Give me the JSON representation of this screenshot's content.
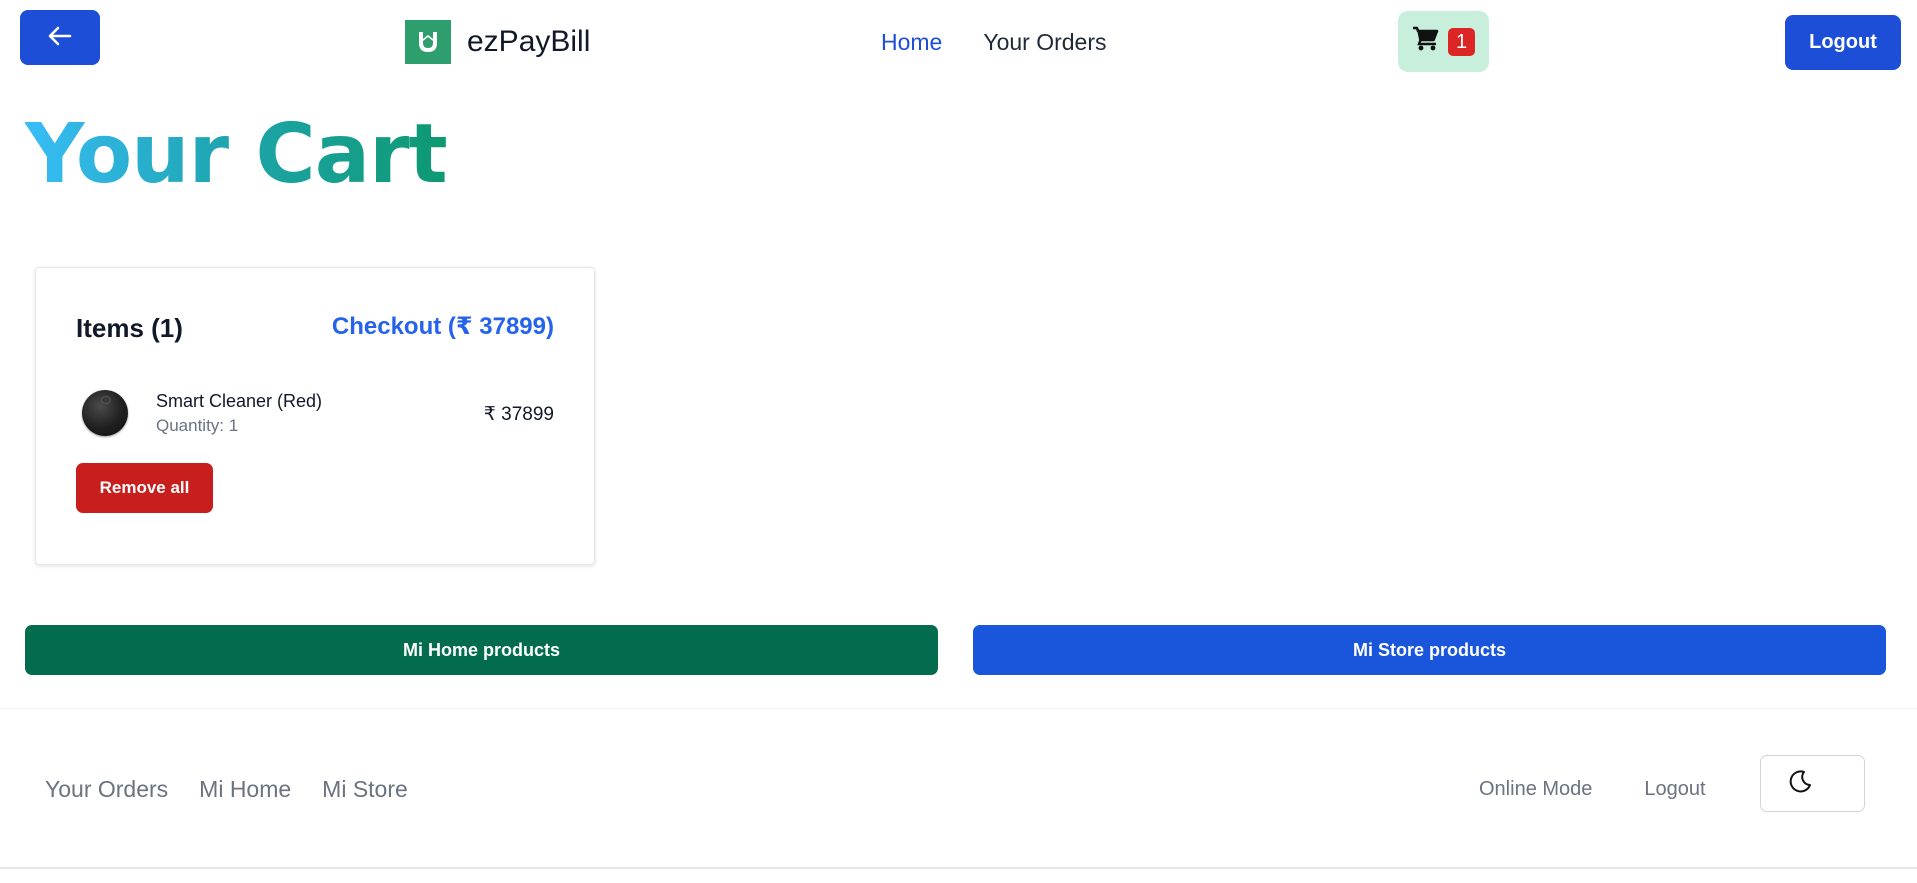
{
  "header": {
    "brand_name": "ezPayBill",
    "nav": [
      {
        "label": "Home",
        "active": true
      },
      {
        "label": "Your Orders",
        "active": false
      }
    ],
    "cart_count": "1",
    "logout_label": "Logout",
    "icons": {
      "back": "arrow-left-icon",
      "logo": "mi-home-logo",
      "cart": "shopping-cart-icon"
    }
  },
  "page": {
    "title": "Your Cart"
  },
  "cart": {
    "items_title": "Items (1)",
    "checkout_label": "Checkout (₹ 37899)",
    "items": [
      {
        "name": "Smart Cleaner (Red)",
        "quantity": "Quantity: 1",
        "price": "₹ 37899"
      }
    ],
    "remove_all_label": "Remove all"
  },
  "product_buttons": {
    "mi_home": "Mi Home products",
    "mi_store": "Mi Store products"
  },
  "footer": {
    "left_links": [
      "Your Orders",
      "Mi Home",
      "Mi Store"
    ],
    "right_links": [
      "Online Mode",
      "Logout"
    ],
    "theme_icon": "moon-icon"
  },
  "colors": {
    "primary": "#1d4ed8",
    "danger": "#c81e1e",
    "mi_home": "#046c4e",
    "mi_store": "#1a56db",
    "cart_bg": "#c8eedc",
    "title_gradient_start": "#38bdf8",
    "title_gradient_end": "#0d9970"
  }
}
